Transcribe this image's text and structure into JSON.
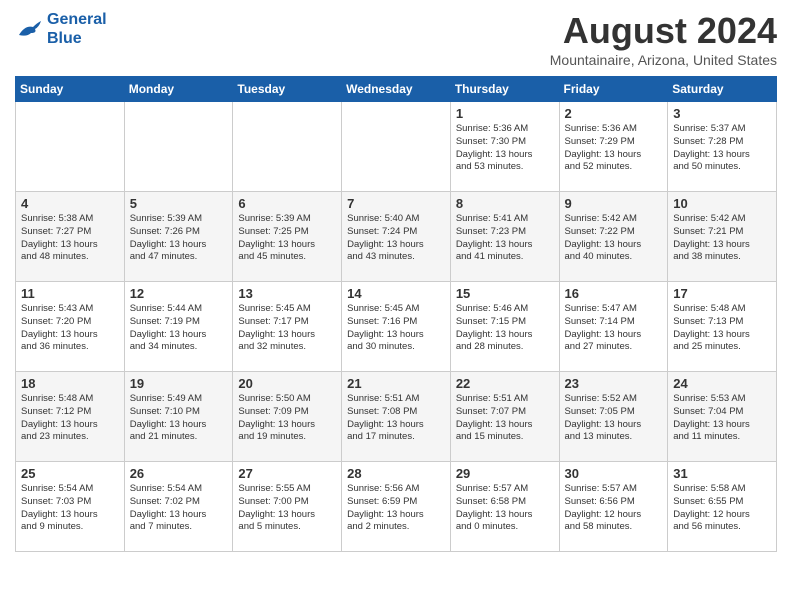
{
  "logo": {
    "line1": "General",
    "line2": "Blue"
  },
  "title": "August 2024",
  "location": "Mountainaire, Arizona, United States",
  "days_of_week": [
    "Sunday",
    "Monday",
    "Tuesday",
    "Wednesday",
    "Thursday",
    "Friday",
    "Saturday"
  ],
  "weeks": [
    [
      {
        "day": "",
        "info": ""
      },
      {
        "day": "",
        "info": ""
      },
      {
        "day": "",
        "info": ""
      },
      {
        "day": "",
        "info": ""
      },
      {
        "day": "1",
        "info": "Sunrise: 5:36 AM\nSunset: 7:30 PM\nDaylight: 13 hours\nand 53 minutes."
      },
      {
        "day": "2",
        "info": "Sunrise: 5:36 AM\nSunset: 7:29 PM\nDaylight: 13 hours\nand 52 minutes."
      },
      {
        "day": "3",
        "info": "Sunrise: 5:37 AM\nSunset: 7:28 PM\nDaylight: 13 hours\nand 50 minutes."
      }
    ],
    [
      {
        "day": "4",
        "info": "Sunrise: 5:38 AM\nSunset: 7:27 PM\nDaylight: 13 hours\nand 48 minutes."
      },
      {
        "day": "5",
        "info": "Sunrise: 5:39 AM\nSunset: 7:26 PM\nDaylight: 13 hours\nand 47 minutes."
      },
      {
        "day": "6",
        "info": "Sunrise: 5:39 AM\nSunset: 7:25 PM\nDaylight: 13 hours\nand 45 minutes."
      },
      {
        "day": "7",
        "info": "Sunrise: 5:40 AM\nSunset: 7:24 PM\nDaylight: 13 hours\nand 43 minutes."
      },
      {
        "day": "8",
        "info": "Sunrise: 5:41 AM\nSunset: 7:23 PM\nDaylight: 13 hours\nand 41 minutes."
      },
      {
        "day": "9",
        "info": "Sunrise: 5:42 AM\nSunset: 7:22 PM\nDaylight: 13 hours\nand 40 minutes."
      },
      {
        "day": "10",
        "info": "Sunrise: 5:42 AM\nSunset: 7:21 PM\nDaylight: 13 hours\nand 38 minutes."
      }
    ],
    [
      {
        "day": "11",
        "info": "Sunrise: 5:43 AM\nSunset: 7:20 PM\nDaylight: 13 hours\nand 36 minutes."
      },
      {
        "day": "12",
        "info": "Sunrise: 5:44 AM\nSunset: 7:19 PM\nDaylight: 13 hours\nand 34 minutes."
      },
      {
        "day": "13",
        "info": "Sunrise: 5:45 AM\nSunset: 7:17 PM\nDaylight: 13 hours\nand 32 minutes."
      },
      {
        "day": "14",
        "info": "Sunrise: 5:45 AM\nSunset: 7:16 PM\nDaylight: 13 hours\nand 30 minutes."
      },
      {
        "day": "15",
        "info": "Sunrise: 5:46 AM\nSunset: 7:15 PM\nDaylight: 13 hours\nand 28 minutes."
      },
      {
        "day": "16",
        "info": "Sunrise: 5:47 AM\nSunset: 7:14 PM\nDaylight: 13 hours\nand 27 minutes."
      },
      {
        "day": "17",
        "info": "Sunrise: 5:48 AM\nSunset: 7:13 PM\nDaylight: 13 hours\nand 25 minutes."
      }
    ],
    [
      {
        "day": "18",
        "info": "Sunrise: 5:48 AM\nSunset: 7:12 PM\nDaylight: 13 hours\nand 23 minutes."
      },
      {
        "day": "19",
        "info": "Sunrise: 5:49 AM\nSunset: 7:10 PM\nDaylight: 13 hours\nand 21 minutes."
      },
      {
        "day": "20",
        "info": "Sunrise: 5:50 AM\nSunset: 7:09 PM\nDaylight: 13 hours\nand 19 minutes."
      },
      {
        "day": "21",
        "info": "Sunrise: 5:51 AM\nSunset: 7:08 PM\nDaylight: 13 hours\nand 17 minutes."
      },
      {
        "day": "22",
        "info": "Sunrise: 5:51 AM\nSunset: 7:07 PM\nDaylight: 13 hours\nand 15 minutes."
      },
      {
        "day": "23",
        "info": "Sunrise: 5:52 AM\nSunset: 7:05 PM\nDaylight: 13 hours\nand 13 minutes."
      },
      {
        "day": "24",
        "info": "Sunrise: 5:53 AM\nSunset: 7:04 PM\nDaylight: 13 hours\nand 11 minutes."
      }
    ],
    [
      {
        "day": "25",
        "info": "Sunrise: 5:54 AM\nSunset: 7:03 PM\nDaylight: 13 hours\nand 9 minutes."
      },
      {
        "day": "26",
        "info": "Sunrise: 5:54 AM\nSunset: 7:02 PM\nDaylight: 13 hours\nand 7 minutes."
      },
      {
        "day": "27",
        "info": "Sunrise: 5:55 AM\nSunset: 7:00 PM\nDaylight: 13 hours\nand 5 minutes."
      },
      {
        "day": "28",
        "info": "Sunrise: 5:56 AM\nSunset: 6:59 PM\nDaylight: 13 hours\nand 2 minutes."
      },
      {
        "day": "29",
        "info": "Sunrise: 5:57 AM\nSunset: 6:58 PM\nDaylight: 13 hours\nand 0 minutes."
      },
      {
        "day": "30",
        "info": "Sunrise: 5:57 AM\nSunset: 6:56 PM\nDaylight: 12 hours\nand 58 minutes."
      },
      {
        "day": "31",
        "info": "Sunrise: 5:58 AM\nSunset: 6:55 PM\nDaylight: 12 hours\nand 56 minutes."
      }
    ]
  ]
}
